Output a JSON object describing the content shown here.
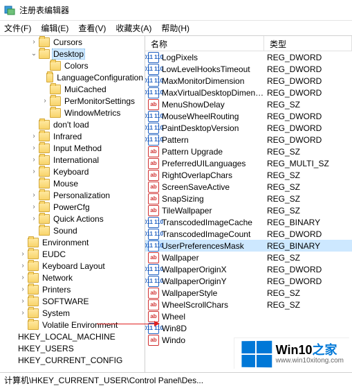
{
  "title": "注册表编辑器",
  "menu": {
    "file": "文件(F)",
    "edit": "编辑(E)",
    "view": "查看(V)",
    "favorites": "收藏夹(A)",
    "help": "帮助(H)"
  },
  "columns": {
    "name": "名称",
    "type": "类型"
  },
  "tree": [
    {
      "indent": 1,
      "twisty": ">",
      "label": "Cursors"
    },
    {
      "indent": 1,
      "twisty": "v",
      "label": "Desktop",
      "selected": true
    },
    {
      "indent": 2,
      "twisty": "",
      "label": "Colors"
    },
    {
      "indent": 2,
      "twisty": "",
      "label": "LanguageConfiguration"
    },
    {
      "indent": 2,
      "twisty": "",
      "label": "MuiCached"
    },
    {
      "indent": 2,
      "twisty": ">",
      "label": "PerMonitorSettings"
    },
    {
      "indent": 2,
      "twisty": "",
      "label": "WindowMetrics"
    },
    {
      "indent": 1,
      "twisty": "",
      "label": "don't load"
    },
    {
      "indent": 1,
      "twisty": ">",
      "label": "Infrared"
    },
    {
      "indent": 1,
      "twisty": ">",
      "label": "Input Method"
    },
    {
      "indent": 1,
      "twisty": ">",
      "label": "International"
    },
    {
      "indent": 1,
      "twisty": ">",
      "label": "Keyboard"
    },
    {
      "indent": 1,
      "twisty": "",
      "label": "Mouse"
    },
    {
      "indent": 1,
      "twisty": ">",
      "label": "Personalization"
    },
    {
      "indent": 1,
      "twisty": ">",
      "label": "PowerCfg"
    },
    {
      "indent": 1,
      "twisty": ">",
      "label": "Quick Actions"
    },
    {
      "indent": 1,
      "twisty": "",
      "label": "Sound"
    },
    {
      "indent": 0,
      "twisty": "",
      "label": "Environment"
    },
    {
      "indent": 0,
      "twisty": ">",
      "label": "EUDC"
    },
    {
      "indent": 0,
      "twisty": ">",
      "label": "Keyboard Layout"
    },
    {
      "indent": 0,
      "twisty": ">",
      "label": "Network"
    },
    {
      "indent": 0,
      "twisty": ">",
      "label": "Printers"
    },
    {
      "indent": 0,
      "twisty": ">",
      "label": "SOFTWARE"
    },
    {
      "indent": 0,
      "twisty": ">",
      "label": "System"
    },
    {
      "indent": 0,
      "twisty": "",
      "label": "Volatile Environment"
    },
    {
      "indent": -1,
      "twisty": "",
      "label": "HKEY_LOCAL_MACHINE",
      "nofolder": true
    },
    {
      "indent": -1,
      "twisty": "",
      "label": "HKEY_USERS",
      "nofolder": true
    },
    {
      "indent": -1,
      "twisty": "",
      "label": "HKEY_CURRENT_CONFIG",
      "nofolder": true
    }
  ],
  "values": [
    {
      "icon": "bin",
      "name": "LogPixels",
      "type": "REG_DWORD"
    },
    {
      "icon": "bin",
      "name": "LowLevelHooksTimeout",
      "type": "REG_DWORD"
    },
    {
      "icon": "bin",
      "name": "MaxMonitorDimension",
      "type": "REG_DWORD"
    },
    {
      "icon": "bin",
      "name": "MaxVirtualDesktopDimension",
      "type": "REG_DWORD"
    },
    {
      "icon": "str",
      "name": "MenuShowDelay",
      "type": "REG_SZ"
    },
    {
      "icon": "bin",
      "name": "MouseWheelRouting",
      "type": "REG_DWORD"
    },
    {
      "icon": "bin",
      "name": "PaintDesktopVersion",
      "type": "REG_DWORD"
    },
    {
      "icon": "bin",
      "name": "Pattern",
      "type": "REG_DWORD"
    },
    {
      "icon": "str",
      "name": "Pattern Upgrade",
      "type": "REG_SZ"
    },
    {
      "icon": "str",
      "name": "PreferredUILanguages",
      "type": "REG_MULTI_SZ"
    },
    {
      "icon": "str",
      "name": "RightOverlapChars",
      "type": "REG_SZ"
    },
    {
      "icon": "str",
      "name": "ScreenSaveActive",
      "type": "REG_SZ"
    },
    {
      "icon": "str",
      "name": "SnapSizing",
      "type": "REG_SZ"
    },
    {
      "icon": "str",
      "name": "TileWallpaper",
      "type": "REG_SZ"
    },
    {
      "icon": "bin",
      "name": "TranscodedImageCache",
      "type": "REG_BINARY"
    },
    {
      "icon": "bin",
      "name": "TranscodedImageCount",
      "type": "REG_DWORD"
    },
    {
      "icon": "bin",
      "name": "UserPreferencesMask",
      "type": "REG_BINARY",
      "selected": true
    },
    {
      "icon": "str",
      "name": "Wallpaper",
      "type": "REG_SZ"
    },
    {
      "icon": "bin",
      "name": "WallpaperOriginX",
      "type": "REG_DWORD"
    },
    {
      "icon": "bin",
      "name": "WallpaperOriginY",
      "type": "REG_DWORD"
    },
    {
      "icon": "str",
      "name": "WallpaperStyle",
      "type": "REG_SZ"
    },
    {
      "icon": "str",
      "name": "WheelScrollChars",
      "type": "REG_SZ"
    },
    {
      "icon": "str",
      "name": "Wheel",
      "type": ""
    },
    {
      "icon": "bin",
      "name": "Win8D",
      "type": ""
    },
    {
      "icon": "str",
      "name": "Windo",
      "type": ""
    }
  ],
  "statusbar": "计算机\\HKEY_CURRENT_USER\\Control Panel\\Des...",
  "watermark": {
    "brand_a": "Win10",
    "brand_b": "之家",
    "url": "www.win10xitong.com"
  }
}
